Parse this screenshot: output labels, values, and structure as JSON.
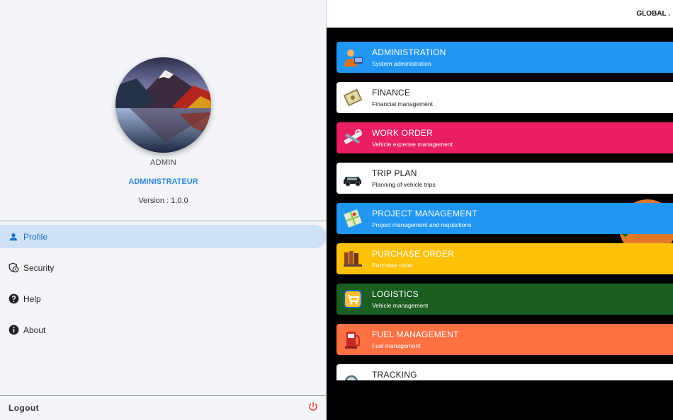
{
  "drawer": {
    "user_name": "ADMIN",
    "user_role": "ADMINISTRATEUR",
    "version": "Version : 1.0.0",
    "menu": [
      {
        "label": "Profile",
        "icon": "person-icon",
        "active": true
      },
      {
        "label": "Security",
        "icon": "security-icon",
        "active": false
      },
      {
        "label": "Help",
        "icon": "help-icon",
        "active": false
      },
      {
        "label": "About",
        "icon": "info-icon",
        "active": false
      }
    ],
    "logout_label": "Logout",
    "logout_icon": "power-icon"
  },
  "header": {
    "title": "GLOBAL ."
  },
  "modules": [
    {
      "title": "ADMINISTRATION",
      "subtitle": "System administration",
      "icon": "administrator-icon",
      "bg": "#2196f3",
      "fg": "#ffffff"
    },
    {
      "title": "FINANCE",
      "subtitle": "Financial management",
      "icon": "money-icon",
      "bg": "#ffffff",
      "fg": "#222222"
    },
    {
      "title": "WORK ORDER",
      "subtitle": "Vehicle expense management",
      "icon": "tools-icon",
      "bg": "#e91e63",
      "fg": "#ffffff"
    },
    {
      "title": "TRIP PLAN",
      "subtitle": "Planning of vehicle trips",
      "icon": "car-icon",
      "bg": "#ffffff",
      "fg": "#222222"
    },
    {
      "title": "PROJECT MANAGEMENT",
      "subtitle": "Project management and requisitions",
      "icon": "map-icon",
      "bg": "#2196f3",
      "fg": "#ffffff"
    },
    {
      "title": "PURCHASE ORDER",
      "subtitle": "Purchase order",
      "icon": "books-icon",
      "bg": "#ffc107",
      "fg": "#ffffff"
    },
    {
      "title": "LOGISTICS",
      "subtitle": "Vehicle management",
      "icon": "cart-icon",
      "bg": "#1b5e20",
      "fg": "#ffffff"
    },
    {
      "title": "FUEL MANAGEMENT",
      "subtitle": "Fuel management",
      "icon": "fuel-pump-icon",
      "bg": "#ff7043",
      "fg": "#ffffff"
    },
    {
      "title": "TRACKING",
      "subtitle": "",
      "icon": "magnifier-icon",
      "bg": "#ffffff",
      "fg": "#222222"
    }
  ]
}
